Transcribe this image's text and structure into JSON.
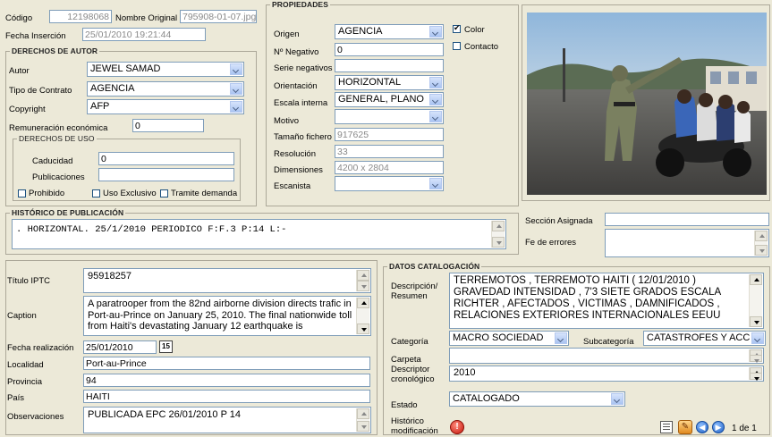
{
  "header": {
    "codigo_label": "Código",
    "codigo_value": "12198068",
    "nombre_original_label": "Nombre Original",
    "nombre_original_value": "795908-01-07.jpg",
    "fecha_insercion_label": "Fecha Inserción",
    "fecha_insercion_value": "25/01/2010 19:21:44"
  },
  "derechos_autor": {
    "title": "DERECHOS DE AUTOR",
    "autor_label": "Autor",
    "autor_value": "JEWEL SAMAD",
    "tipo_contrato_label": "Tipo de Contrato",
    "tipo_contrato_value": "AGENCIA",
    "copyright_label": "Copyright",
    "copyright_value": "AFP",
    "remuneracion_label": "Remuneración económica",
    "remuneracion_value": "0"
  },
  "derechos_uso": {
    "title": "DERECHOS DE USO",
    "caducidad_label": "Caducidad",
    "caducidad_value": "0",
    "publicaciones_label": "Publicaciones",
    "publicaciones_value": "",
    "prohibido_label": "Prohibido",
    "uso_exclusivo_label": "Uso Exclusivo",
    "tramite_label": "Tramite demanda"
  },
  "propiedades": {
    "title": "PROPIEDADES",
    "origen_label": "Origen",
    "origen_value": "AGENCIA",
    "color_label": "Color",
    "contacto_label": "Contacto",
    "negativo_label": "Nº Negativo",
    "negativo_value": "0",
    "serie_label": "Serie negativos",
    "serie_value": "",
    "orientacion_label": "Orientación",
    "orientacion_value": "HORIZONTAL",
    "escala_label": "Escala interna",
    "escala_value": "GENERAL, PLANO",
    "motivo_label": "Motivo",
    "motivo_value": "",
    "tamano_label": "Tamaño fichero",
    "tamano_value": "917625",
    "resolucion_label": "Resolución",
    "resolucion_value": "33",
    "dimensiones_label": "Dimensiones",
    "dimensiones_value": "4200 x 2804",
    "escanista_label": "Escanista",
    "escanista_value": ""
  },
  "historico": {
    "title": "HISTÓRICO DE PUBLICACIÓN",
    "text": ". HORIZONTAL. 25/1/2010   PERIODICO F:F.3 P:14 L:-"
  },
  "seccion": {
    "seccion_label": "Sección Asignada",
    "seccion_value": "",
    "fe_errores_label": "Fe de errores",
    "fe_errores_value": ""
  },
  "iptc": {
    "titulo_label": "Título IPTC",
    "titulo_value": "95918257",
    "caption_label": "Caption",
    "caption_value": "A paratrooper from the 82nd airborne division directs trafic in Port-au-Prince on January 25, 2010. The final nationwide toll from Haiti's devastating January 12 earthquake is",
    "fecha_realizacion_label": "Fecha realización",
    "fecha_realizacion_value": "25/01/2010",
    "calendar_label": "15",
    "localidad_label": "Localidad",
    "localidad_value": "Port-au-Prince",
    "provincia_label": "Provincia",
    "provincia_value": "94",
    "pais_label": "País",
    "pais_value": "HAITI",
    "observaciones_label": "Observaciones",
    "observaciones_value": "PUBLICADA EPC 26/01/2010 P 14"
  },
  "catalogacion": {
    "title": "DATOS CATALOGACIÓN",
    "descripcion_label_1": "Descripción/",
    "descripcion_label_2": "Resumen",
    "descripcion_value": "TERREMOTOS , TERREMOTO HAITI ( 12/01/2010 ) GRAVEDAD INTENSIDAD , 7'3 SIETE GRADOS ESCALA RICHTER , AFECTADOS , VICTIMAS , DAMNIFICADOS , RELACIONES EXTERIORES INTERNACIONALES EEUU",
    "categoria_label": "Categoría",
    "categoria_value": "MACRO SOCIEDAD",
    "subcategoria_label": "Subcategoría",
    "subcategoria_value": "CATASTROFES Y ACC",
    "carpeta_label": "Carpeta",
    "carpeta_value": "",
    "descriptor_label_1": "Descriptor",
    "descriptor_label_2": "cronológico",
    "descriptor_value": "2010",
    "estado_label": "Estado",
    "estado_value": "CATALOGADO",
    "historico_label_1": "Histórico",
    "historico_label_2": "modificación"
  },
  "pager": {
    "text": "1 de 1"
  }
}
